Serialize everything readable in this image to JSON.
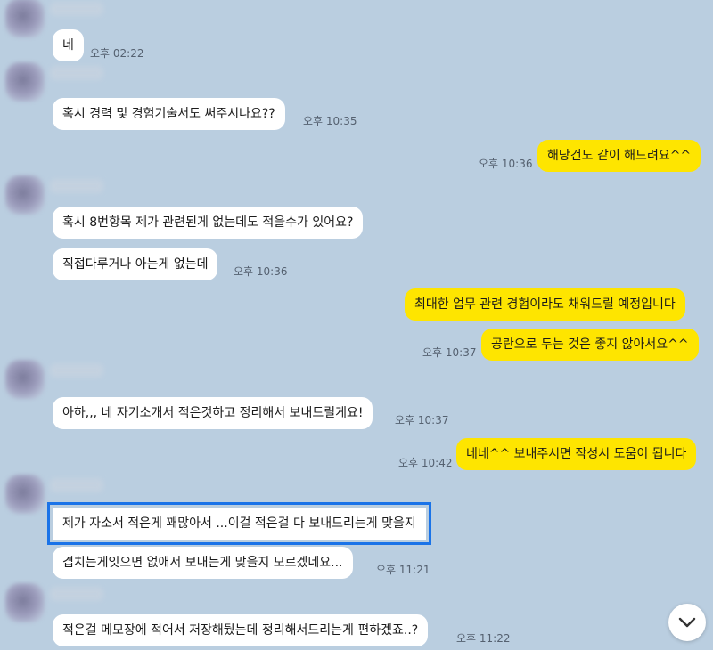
{
  "messages": [
    {
      "id": 1,
      "side": "in",
      "text": "네",
      "time": "오후 02:22"
    },
    {
      "id": 2,
      "side": "in",
      "text": "혹시 경력 및 경험기술서도 써주시나요??",
      "time": "오후 10:35"
    },
    {
      "id": 3,
      "side": "out",
      "text": "해당건도 같이 해드려요^^",
      "time": "오후 10:36"
    },
    {
      "id": 4,
      "side": "in",
      "text": "혹시 8번항목 제가 관련된게 없는데도 적을수가 있어요?",
      "time": ""
    },
    {
      "id": 5,
      "side": "in",
      "text": "직접다루거나 아는게 없는데",
      "time": "오후 10:36"
    },
    {
      "id": 6,
      "side": "out",
      "text": "최대한 업무 관련 경험이라도 채워드릴 예정입니다",
      "time": ""
    },
    {
      "id": 7,
      "side": "out",
      "text": "공란으로 두는 것은 좋지 않아서요^^",
      "time": "오후 10:37"
    },
    {
      "id": 8,
      "side": "in",
      "text": "아하,,, 네 자기소개서 적은것하고 정리해서 보내드릴게요!",
      "time": "오후 10:37"
    },
    {
      "id": 9,
      "side": "out",
      "text": "네네^^ 보내주시면 작성시 도움이 됩니다",
      "time": "오후 10:42"
    },
    {
      "id": 10,
      "side": "in",
      "text": "제가 자소서 적은게 꽤많아서 ...이걸 적은걸 다 보내드리는게 맞을지",
      "time": "",
      "highlighted": true
    },
    {
      "id": 11,
      "side": "in",
      "text": "겹치는게잇으면 없애서 보내는게 맞을지 모르겠네요...",
      "time": "오후 11:21"
    },
    {
      "id": 12,
      "side": "in",
      "text": "적은걸 메모장에 적어서 저장해뒀는데 정리해서드리는게 편하겠죠..?",
      "time": "오후 11:22"
    }
  ],
  "icons": {
    "scroll_down": "chevron-down-icon"
  },
  "colors": {
    "background": "#bacee0",
    "incoming": "#ffffff",
    "outgoing": "#fee500",
    "highlight": "#1a73e8"
  }
}
